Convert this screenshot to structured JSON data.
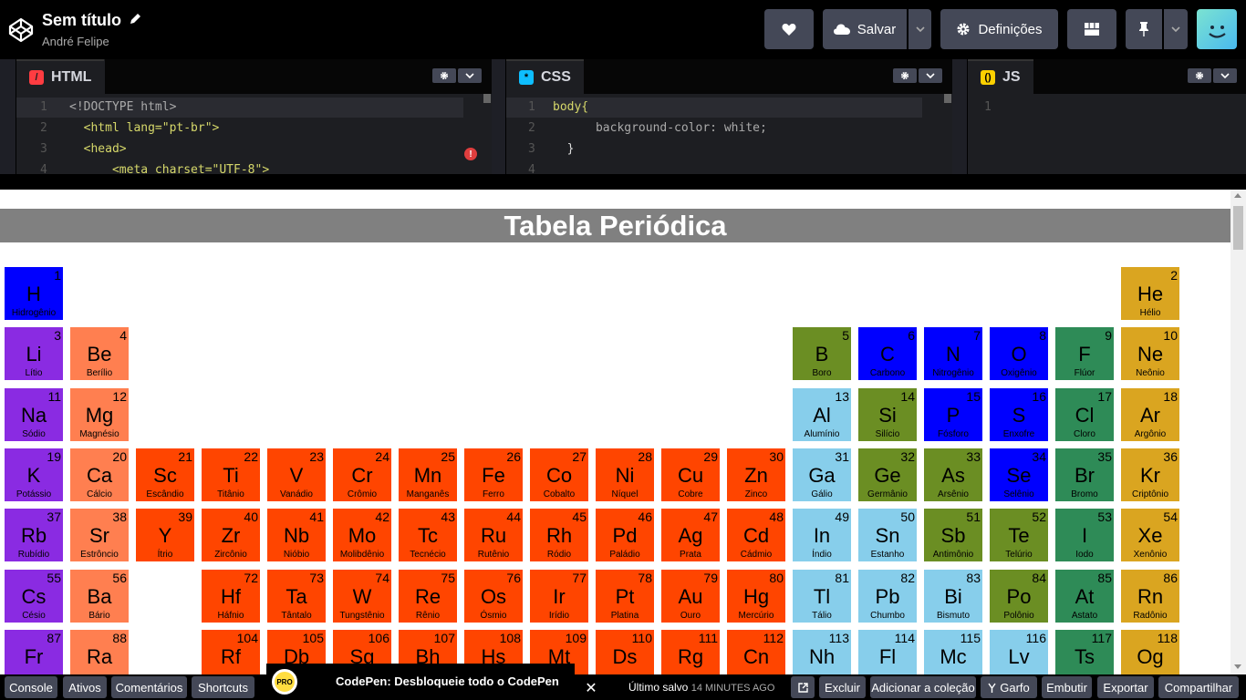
{
  "header": {
    "title": "Sem título",
    "author": "André Felipe",
    "save_label": "Salvar",
    "settings_label": "Definições"
  },
  "editor": {
    "panes": [
      {
        "label": "HTML",
        "icon": "slash-icon",
        "icon_color": "#ff3c41",
        "lines": [
          {
            "n": "1",
            "t": "<!DOCTYPE html>"
          },
          {
            "n": "2",
            "t": "  <html lang=\"pt-br\">"
          },
          {
            "n": "3",
            "t": "  <head>"
          },
          {
            "n": "4",
            "t": "      <meta charset=\"UTF-8\">"
          }
        ]
      },
      {
        "label": "CSS",
        "icon": "asterisk-icon",
        "icon_color": "#0ebeff",
        "lines": [
          {
            "n": "1",
            "t": "body{"
          },
          {
            "n": "2",
            "t": "      background-color: white;"
          },
          {
            "n": "3",
            "t": "  }"
          },
          {
            "n": "4",
            "t": ""
          }
        ]
      },
      {
        "label": "JS",
        "icon": "braces-icon",
        "icon_color": "#fcd000",
        "lines": [
          {
            "n": "1",
            "t": ""
          }
        ]
      }
    ]
  },
  "preview": {
    "title": "Tabela Periódica",
    "elements": [
      [
        "H",
        "Hidrogênio",
        1,
        1,
        1,
        "#0000ff"
      ],
      [
        "He",
        "Hélio",
        2,
        18,
        1,
        "#daa520"
      ],
      [
        "Li",
        "Lítio",
        3,
        1,
        2,
        "#8a2be2"
      ],
      [
        "Be",
        "Berílio",
        4,
        2,
        2,
        "#ff7f50"
      ],
      [
        "B",
        "Boro",
        5,
        13,
        2,
        "#6b8e23"
      ],
      [
        "C",
        "Carbono",
        6,
        14,
        2,
        "#0000ff"
      ],
      [
        "N",
        "Nitrogênio",
        7,
        15,
        2,
        "#0000ff"
      ],
      [
        "O",
        "Oxigênio",
        8,
        16,
        2,
        "#0000ff"
      ],
      [
        "F",
        "Flúor",
        9,
        17,
        2,
        "#2e8b57"
      ],
      [
        "Ne",
        "Neônio",
        10,
        18,
        2,
        "#daa520"
      ],
      [
        "Na",
        "Sódio",
        11,
        1,
        3,
        "#8a2be2"
      ],
      [
        "Mg",
        "Magnésio",
        12,
        2,
        3,
        "#ff7f50"
      ],
      [
        "Al",
        "Alumínio",
        13,
        13,
        3,
        "#87ceeb"
      ],
      [
        "Si",
        "Silício",
        14,
        14,
        3,
        "#6b8e23"
      ],
      [
        "P",
        "Fósforo",
        15,
        15,
        3,
        "#0000ff"
      ],
      [
        "S",
        "Enxofre",
        16,
        16,
        3,
        "#0000ff"
      ],
      [
        "Cl",
        "Cloro",
        17,
        17,
        3,
        "#2e8b57"
      ],
      [
        "Ar",
        "Argônio",
        18,
        18,
        3,
        "#daa520"
      ],
      [
        "K",
        "Potássio",
        19,
        1,
        4,
        "#8a2be2"
      ],
      [
        "Ca",
        "Cálcio",
        20,
        2,
        4,
        "#ff7f50"
      ],
      [
        "Sc",
        "Escândio",
        21,
        3,
        4,
        "#ff4500"
      ],
      [
        "Ti",
        "Titânio",
        22,
        4,
        4,
        "#ff4500"
      ],
      [
        "V",
        "Vanádio",
        23,
        5,
        4,
        "#ff4500"
      ],
      [
        "Cr",
        "Crômio",
        24,
        6,
        4,
        "#ff4500"
      ],
      [
        "Mn",
        "Manganês",
        25,
        7,
        4,
        "#ff4500"
      ],
      [
        "Fe",
        "Ferro",
        26,
        8,
        4,
        "#ff4500"
      ],
      [
        "Co",
        "Cobalto",
        27,
        9,
        4,
        "#ff4500"
      ],
      [
        "Ni",
        "Níquel",
        28,
        10,
        4,
        "#ff4500"
      ],
      [
        "Cu",
        "Cobre",
        29,
        11,
        4,
        "#ff4500"
      ],
      [
        "Zn",
        "Zinco",
        30,
        12,
        4,
        "#ff4500"
      ],
      [
        "Ga",
        "Gálio",
        31,
        13,
        4,
        "#87ceeb"
      ],
      [
        "Ge",
        "Germânio",
        32,
        14,
        4,
        "#6b8e23"
      ],
      [
        "As",
        "Arsênio",
        33,
        15,
        4,
        "#6b8e23"
      ],
      [
        "Se",
        "Selênio",
        34,
        16,
        4,
        "#0000ff"
      ],
      [
        "Br",
        "Bromo",
        35,
        17,
        4,
        "#2e8b57"
      ],
      [
        "Kr",
        "Criptônio",
        36,
        18,
        4,
        "#daa520"
      ],
      [
        "Rb",
        "Rubídio",
        37,
        1,
        5,
        "#8a2be2"
      ],
      [
        "Sr",
        "Estrôncio",
        38,
        2,
        5,
        "#ff7f50"
      ],
      [
        "Y",
        "Ítrio",
        39,
        3,
        5,
        "#ff4500"
      ],
      [
        "Zr",
        "Zircônio",
        40,
        4,
        5,
        "#ff4500"
      ],
      [
        "Nb",
        "Nióbio",
        41,
        5,
        5,
        "#ff4500"
      ],
      [
        "Mo",
        "Molibdênio",
        42,
        6,
        5,
        "#ff4500"
      ],
      [
        "Tc",
        "Tecnécio",
        43,
        7,
        5,
        "#ff4500"
      ],
      [
        "Ru",
        "Rutênio",
        44,
        8,
        5,
        "#ff4500"
      ],
      [
        "Rh",
        "Ródio",
        45,
        9,
        5,
        "#ff4500"
      ],
      [
        "Pd",
        "Paládio",
        46,
        10,
        5,
        "#ff4500"
      ],
      [
        "Ag",
        "Prata",
        47,
        11,
        5,
        "#ff4500"
      ],
      [
        "Cd",
        "Cádmio",
        48,
        12,
        5,
        "#ff4500"
      ],
      [
        "In",
        "Índio",
        49,
        13,
        5,
        "#87ceeb"
      ],
      [
        "Sn",
        "Estanho",
        50,
        14,
        5,
        "#87ceeb"
      ],
      [
        "Sb",
        "Antimônio",
        51,
        15,
        5,
        "#6b8e23"
      ],
      [
        "Te",
        "Telúrio",
        52,
        16,
        5,
        "#6b8e23"
      ],
      [
        "I",
        "Iodo",
        53,
        17,
        5,
        "#2e8b57"
      ],
      [
        "Xe",
        "Xenônio",
        54,
        18,
        5,
        "#daa520"
      ],
      [
        "Cs",
        "Césio",
        55,
        1,
        6,
        "#8a2be2"
      ],
      [
        "Ba",
        "Bário",
        56,
        2,
        6,
        "#ff7f50"
      ],
      [
        "Hf",
        "Háfnio",
        72,
        4,
        6,
        "#ff4500"
      ],
      [
        "Ta",
        "Tântalo",
        73,
        5,
        6,
        "#ff4500"
      ],
      [
        "W",
        "Tungstênio",
        74,
        6,
        6,
        "#ff4500"
      ],
      [
        "Re",
        "Rênio",
        75,
        7,
        6,
        "#ff4500"
      ],
      [
        "Os",
        "Ósmio",
        76,
        8,
        6,
        "#ff4500"
      ],
      [
        "Ir",
        "Irídio",
        77,
        9,
        6,
        "#ff4500"
      ],
      [
        "Pt",
        "Platina",
        78,
        10,
        6,
        "#ff4500"
      ],
      [
        "Au",
        "Ouro",
        79,
        11,
        6,
        "#ff4500"
      ],
      [
        "Hg",
        "Mercúrio",
        80,
        12,
        6,
        "#ff4500"
      ],
      [
        "Tl",
        "Tálio",
        81,
        13,
        6,
        "#87ceeb"
      ],
      [
        "Pb",
        "Chumbo",
        82,
        14,
        6,
        "#87ceeb"
      ],
      [
        "Bi",
        "Bismuto",
        83,
        15,
        6,
        "#87ceeb"
      ],
      [
        "Po",
        "Polônio",
        84,
        16,
        6,
        "#6b8e23"
      ],
      [
        "At",
        "Astato",
        85,
        17,
        6,
        "#2e8b57"
      ],
      [
        "Rn",
        "Radônio",
        86,
        18,
        6,
        "#daa520"
      ],
      [
        "Fr",
        "",
        87,
        1,
        7,
        "#8a2be2"
      ],
      [
        "Ra",
        "",
        88,
        2,
        7,
        "#ff7f50"
      ],
      [
        "Rf",
        "",
        104,
        4,
        7,
        "#ff4500"
      ],
      [
        "Db",
        "",
        105,
        5,
        7,
        "#ff4500"
      ],
      [
        "Sg",
        "",
        106,
        6,
        7,
        "#ff4500"
      ],
      [
        "Bh",
        "",
        107,
        7,
        7,
        "#ff4500"
      ],
      [
        "Hs",
        "",
        108,
        8,
        7,
        "#ff4500"
      ],
      [
        "Mt",
        "",
        109,
        9,
        7,
        "#ff4500"
      ],
      [
        "Ds",
        "",
        110,
        10,
        7,
        "#ff4500"
      ],
      [
        "Rg",
        "",
        111,
        11,
        7,
        "#ff4500"
      ],
      [
        "Cn",
        "",
        112,
        12,
        7,
        "#ff4500"
      ],
      [
        "Nh",
        "",
        113,
        13,
        7,
        "#87ceeb"
      ],
      [
        "Fl",
        "",
        114,
        14,
        7,
        "#87ceeb"
      ],
      [
        "Mc",
        "",
        115,
        15,
        7,
        "#87ceeb"
      ],
      [
        "Lv",
        "",
        116,
        16,
        7,
        "#87ceeb"
      ],
      [
        "Ts",
        "",
        117,
        17,
        7,
        "#2e8b57"
      ],
      [
        "Og",
        "",
        118,
        18,
        7,
        "#daa520"
      ]
    ]
  },
  "footer": {
    "console": "Console",
    "assets": "Ativos",
    "comments": "Comentários",
    "shortcuts": "Shortcuts",
    "promo_badge": "PRO",
    "promo": "CodePen: Desbloqueie todo o CodePen",
    "saved_label": "Último salvo",
    "saved_time": "14 MINUTES AGO",
    "delete": "Excluir",
    "add_collection": "Adicionar a coleção",
    "fork": "Garfo",
    "embed": "Embutir",
    "export": "Exportar",
    "share": "Compartilhar"
  }
}
